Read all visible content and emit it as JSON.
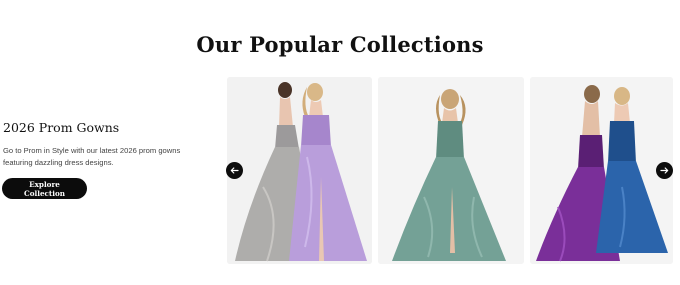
{
  "section": {
    "title": "Our Popular Collections"
  },
  "promo": {
    "title": "2026 Prom Gowns",
    "description": "Go to Prom in Style with our latest 2026 prom gowns featuring dazzling dress designs.",
    "button_label": "Explore Collection"
  },
  "carousel": {
    "prev_icon": "arrow-left-icon",
    "next_icon": "arrow-right-icon",
    "cards": [
      {
        "image": "two models in silver-grey and lavender sequin tulle gowns"
      },
      {
        "image": "model in sage green sequin tulle gown"
      },
      {
        "image": "two models in purple and royal blue sequin tulle gowns"
      }
    ]
  },
  "colors": {
    "button_bg": "#0c0c0c",
    "button_text": "#ffffff",
    "gown_silver": "#a9a7a6",
    "gown_lavender": "#b49ad6",
    "gown_sage": "#6e9a8e",
    "gown_purple": "#6f2a8c",
    "gown_blue": "#245a9a"
  }
}
